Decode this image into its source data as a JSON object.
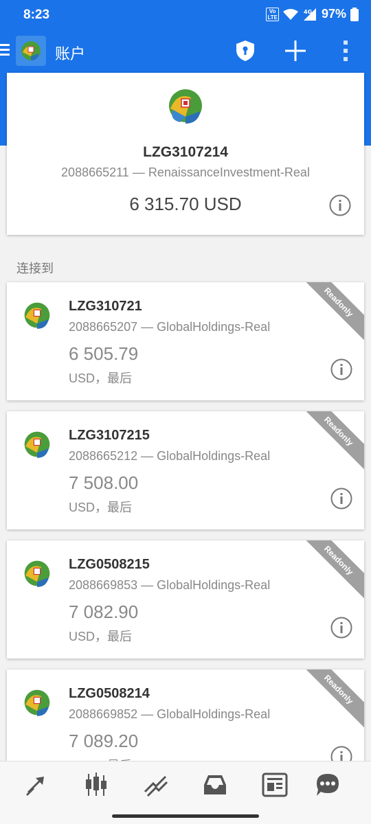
{
  "status_bar": {
    "time": "8:23",
    "volte": "Vo LTE",
    "network": "4G",
    "battery": "97%"
  },
  "toolbar": {
    "title": "账户"
  },
  "main_account": {
    "login": "LZG3107214",
    "server": "2088665211 — RenaissanceInvestment-Real",
    "balance": "6 315.70 USD"
  },
  "section_label": "连接到",
  "accounts": [
    {
      "login": "LZG310721",
      "server": "2088665207 — GlobalHoldings-Real",
      "balance": "6 505.79",
      "sub": "USD，最后",
      "badge": "Readonly"
    },
    {
      "login": "LZG3107215",
      "server": "2088665212 — GlobalHoldings-Real",
      "balance": "7 508.00",
      "sub": "USD，最后",
      "badge": "Readonly"
    },
    {
      "login": "LZG0508215",
      "server": "2088669853 — GlobalHoldings-Real",
      "balance": "7 082.90",
      "sub": "USD，最后",
      "badge": "Readonly"
    },
    {
      "login": "LZG0508214",
      "server": "2088669852 — GlobalHoldings-Real",
      "balance": "7 089.20",
      "sub": "USD，最后",
      "badge": "Readonly"
    }
  ],
  "bottom_nav": [
    "quotes-icon",
    "chart-icon",
    "trade-icon",
    "history-icon",
    "news-icon",
    "chat-icon"
  ],
  "colors": {
    "primary": "#1a73e8",
    "badge": "#a0a0a0",
    "icon_gray": "#555555"
  }
}
